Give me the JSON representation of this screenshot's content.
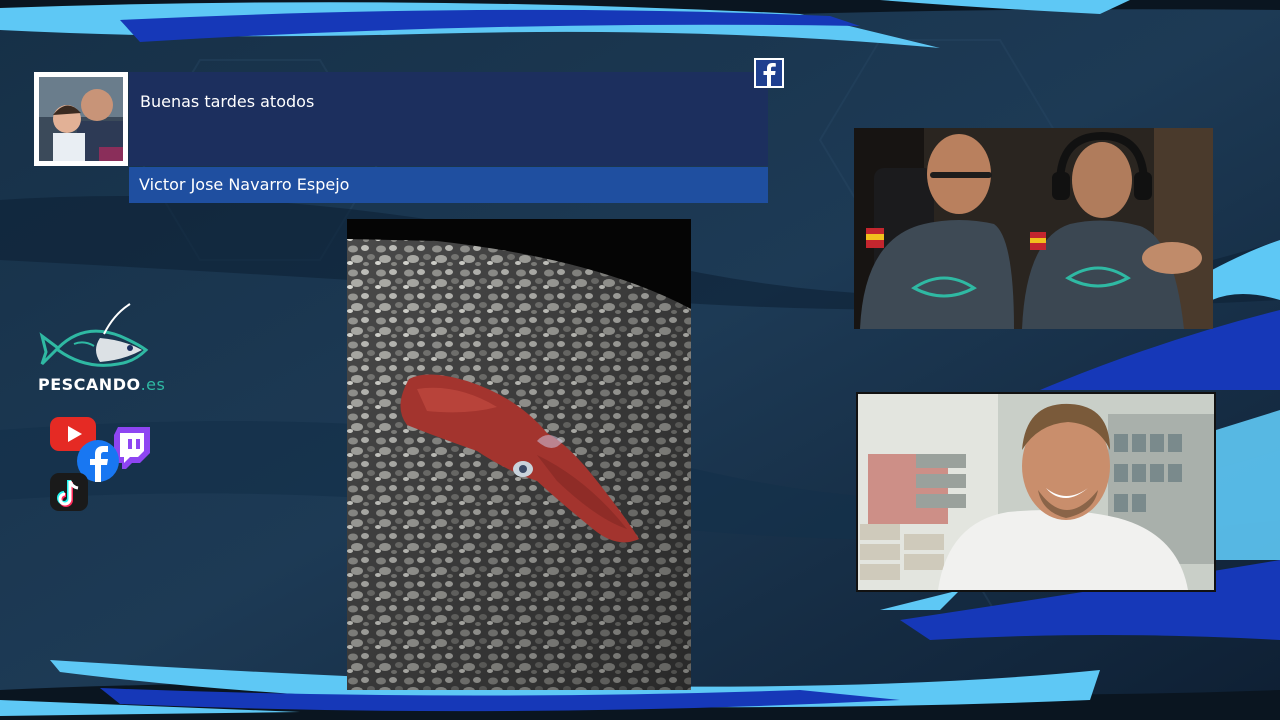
{
  "comment": {
    "text": "Buenas tardes atodos",
    "author": "Victor Jose Navarro Espejo",
    "platform": "facebook-icon"
  },
  "brand": {
    "name": "PESCANDO",
    "tld": ".es"
  },
  "social_icons": [
    "youtube-icon",
    "facebook-icon",
    "twitch-icon",
    "tiktok-icon"
  ],
  "colors": {
    "comment_bg": "#1c2f5e",
    "author_bg": "#1f4fa0",
    "accent_teal": "#2fb9a3",
    "stripe_light": "#5ec8f5",
    "stripe_dark": "#1638b8"
  }
}
